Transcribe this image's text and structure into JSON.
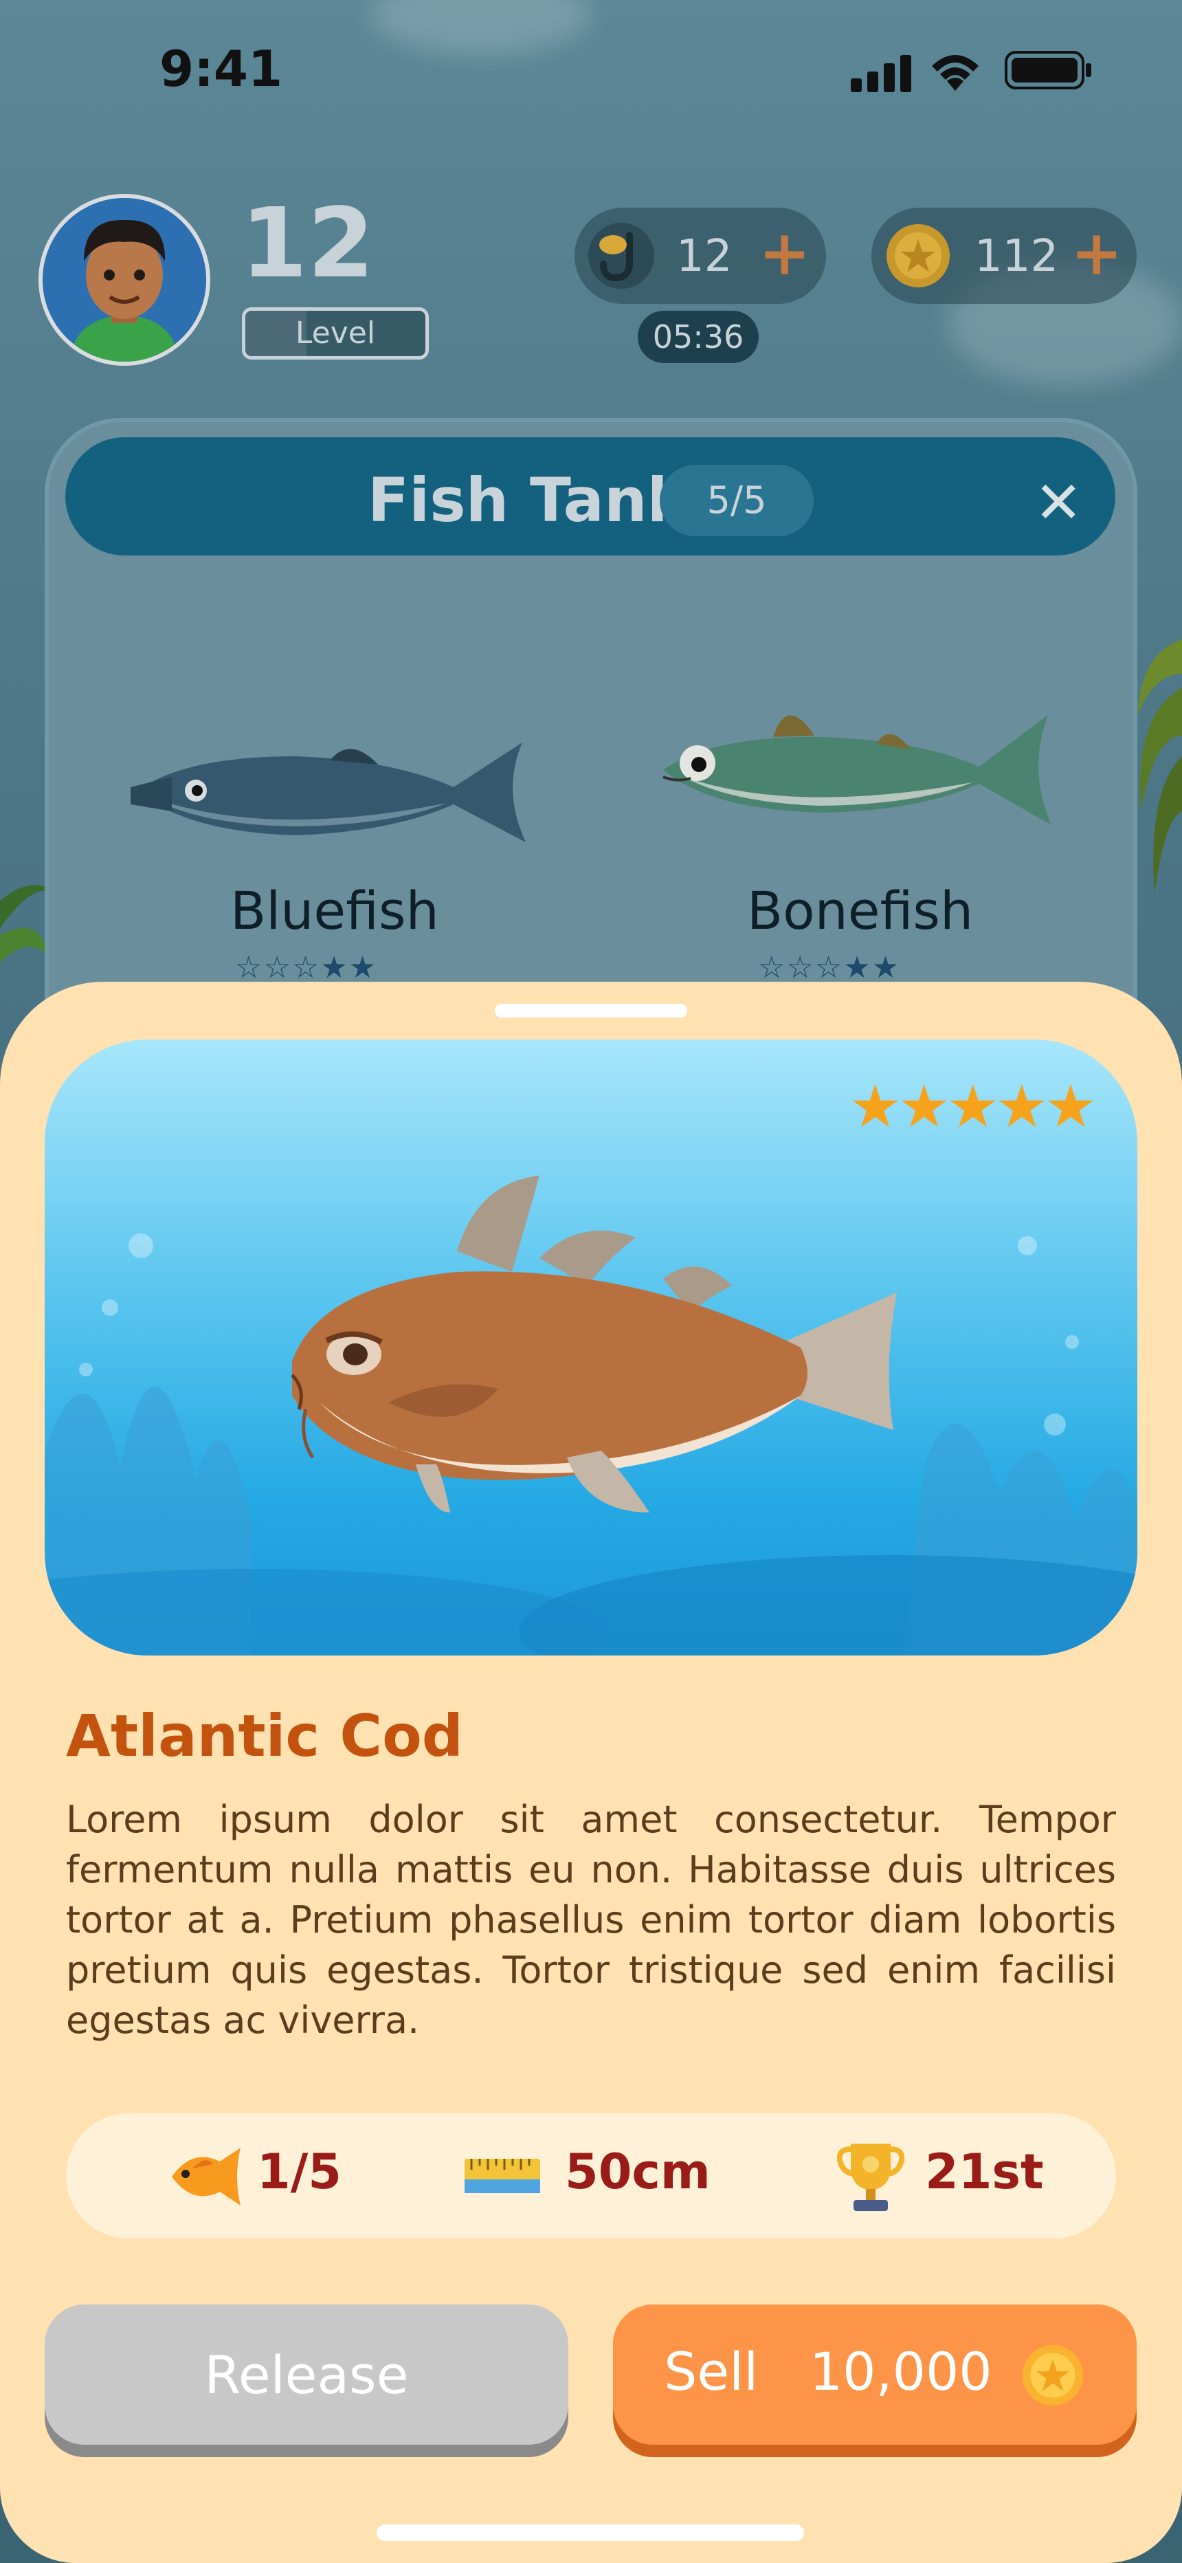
{
  "status_bar": {
    "time": "9:41"
  },
  "hud": {
    "level": "12",
    "level_label": "Level",
    "level_progress": 0.34,
    "bait_count": "12",
    "bait_timer": "05:36",
    "coins": "112",
    "plus": "+"
  },
  "tank": {
    "title": "Fish Tank",
    "count": "5/5",
    "close": "✕",
    "fish": [
      {
        "name": "Bluefish",
        "stars": 2,
        "max_stars": 5
      },
      {
        "name": "Bonefish",
        "stars": 2,
        "max_stars": 5
      }
    ]
  },
  "detail": {
    "rating": 5,
    "stars": "★★★★★",
    "name": "Atlantic Cod",
    "description": "Lorem ipsum dolor sit amet consectetur. Tempor fermentum nulla mattis eu non. Habitasse duis ultrices tortor at a. Pretium phasellus enim tortor diam lobortis pretium quis egestas. Tortor tristique sed enim facilisi egestas ac viverra.",
    "stats": {
      "count": "1/5",
      "length": "50cm",
      "rank": "21st"
    },
    "release_label": "Release",
    "sell_label": "Sell",
    "sell_price": "10,000"
  },
  "colors": {
    "sheet": "#ffe1b2",
    "accent_orange": "#fe9447",
    "title_orange": "#c2520e",
    "stat_red": "#9a1c18",
    "tank_header": "#14617f"
  }
}
